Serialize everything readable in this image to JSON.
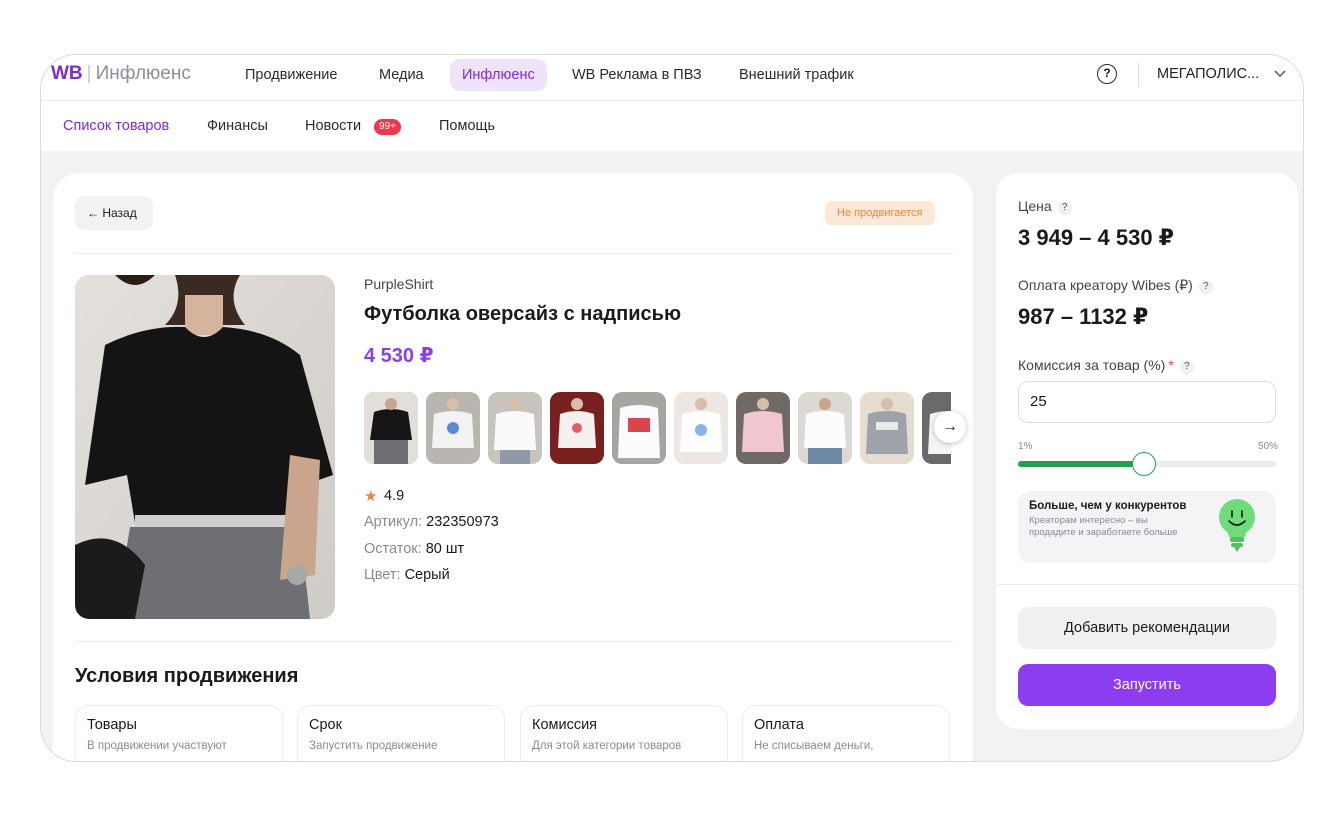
{
  "app": {
    "logo_brand": "WB",
    "logo_name": "Инфлюенс"
  },
  "top_nav": {
    "items": [
      {
        "label": "Продвижение"
      },
      {
        "label": "Медиа"
      },
      {
        "label": "Инфлюенс",
        "active": true
      },
      {
        "label": "WB Реклама в ПВЗ"
      },
      {
        "label": "Внешний трафик"
      }
    ],
    "help_icon": "question-circle-icon",
    "account_name": "МЕГАПОЛИС...",
    "account_chevron": "chevron-down-icon"
  },
  "sub_nav": {
    "items": [
      {
        "label": "Список товаров",
        "active": true
      },
      {
        "label": "Финансы"
      },
      {
        "label": "Новости",
        "badge": "99+"
      },
      {
        "label": "Помощь"
      }
    ]
  },
  "product": {
    "back_label": "Назад",
    "status": "Не продвигается",
    "brand": "PurpleShirt",
    "title": "Футболка оверсайз с надписью",
    "price": "4 530 ₽",
    "thumbnail_count": 10,
    "selected_thumbnail": 0,
    "rating": "4.9",
    "article_label": "Артикул:",
    "article_value": "232350973",
    "stock_label": "Остаток:",
    "stock_value": "80 шт",
    "color_label": "Цвет:",
    "color_value": "Серый"
  },
  "conditions": {
    "title": "Условия продвижения",
    "cards": [
      {
        "title": "Товары",
        "desc": "В продвижении участвуют"
      },
      {
        "title": "Срок",
        "desc": "Запустить продвижение"
      },
      {
        "title": "Комиссия",
        "desc": "Для этой категории товаров"
      },
      {
        "title": "Оплата",
        "desc": "Не списываем деньги,"
      }
    ]
  },
  "sidebar": {
    "price_label": "Цена",
    "price_value": "3 949 – 4 530 ₽",
    "payout_label": "Оплата креатору Wibes (₽)",
    "payout_value": "987 – 1132 ₽",
    "commission_label": "Комиссия за товар (%)",
    "commission_required": "*",
    "commission_value": "25",
    "range_min_label": "1%",
    "range_max_label": "50%",
    "range_min": 1,
    "range_max": 50,
    "hint_title": "Больше, чем у конкурентов",
    "hint_desc": "Креаторам интересно – вы продадите и заработаете больше",
    "hint_icon": "lightbulb-smile-icon",
    "secondary_button": "Добавить рекомендации",
    "primary_button": "Запустить"
  },
  "colors": {
    "accent": "#8c3df0",
    "brand": "#7b2bd9",
    "success": "#22a04b",
    "warning_text": "#f08a3d",
    "badge": "#f2374a"
  }
}
